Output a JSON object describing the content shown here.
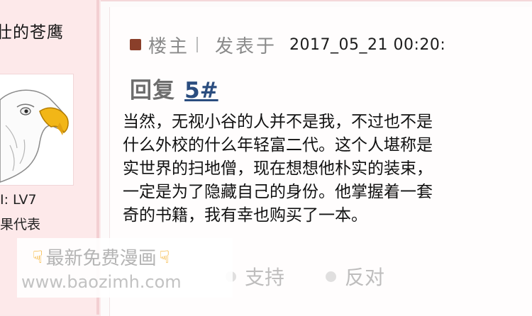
{
  "author": {
    "name": "壮的苍鹰",
    "level": "I: LV7",
    "role": "果代表",
    "avatar_icon": "eagle-icon"
  },
  "post": {
    "floor_label": "楼主",
    "posted_label": "发表于",
    "posted_time": "2017_05_21   00:20:",
    "reply_label": "回复",
    "reply_floor": "5#",
    "content_lines": [
      "当然，无视小谷的人并不是我，不过也不是",
      "什么外校的什么年轻富二代。这个人堪称是",
      "实世界的扫地僧，现在想想他朴实的装束，",
      "一定是为了隐藏自己的身份。他掌握着一套",
      "奇的书籍，我有幸也购买了一本。"
    ],
    "support_label": "支持",
    "oppose_label": "反对"
  },
  "watermark": {
    "title": "最新免费漫画",
    "url": "www.baozimh.com",
    "hand_icon": "pointing-hand-icon"
  },
  "colors": {
    "sidebar_bg": "#fde9ea",
    "link": "#2b4d7f",
    "watermark_hand": "#f2a000"
  }
}
